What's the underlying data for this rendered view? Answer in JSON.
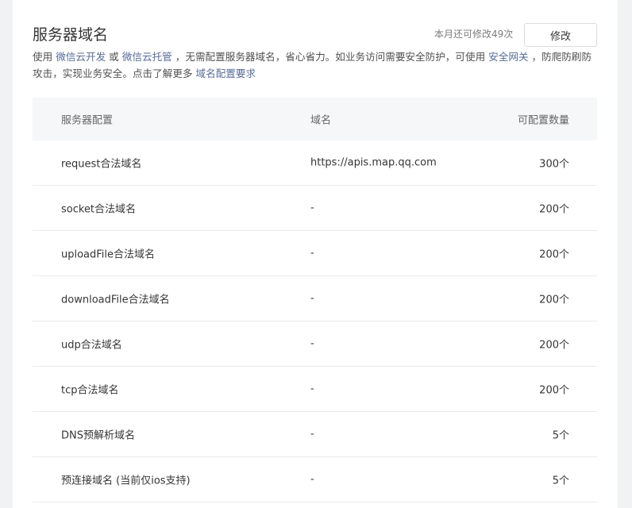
{
  "header": {
    "title": "服务器域名",
    "quota_text": "本月还可修改49次",
    "edit_label": "修改"
  },
  "description": {
    "p1": "使用 ",
    "link_cloud_dev": "微信云开发",
    "p2": " 或 ",
    "link_cloud_hosting": "微信云托管",
    "p3": " ，无需配置服务器域名，省心省力。如业务访问需要安全防护，可使用 ",
    "link_gateway": "安全网关",
    "p4": " ，防爬防刷防攻击，实现业务安全。点击了解更多 ",
    "link_domain_req": "域名配置要求"
  },
  "table": {
    "headers": {
      "config": "服务器配置",
      "domain": "域名",
      "count": "可配置数量"
    },
    "rows": [
      {
        "config": "request合法域名",
        "domain": "https://apis.map.qq.com",
        "count": "300个"
      },
      {
        "config": "socket合法域名",
        "domain": "-",
        "count": "200个"
      },
      {
        "config": "uploadFile合法域名",
        "domain": "-",
        "count": "200个"
      },
      {
        "config": "downloadFile合法域名",
        "domain": "-",
        "count": "200个"
      },
      {
        "config": "udp合法域名",
        "domain": "-",
        "count": "200个"
      },
      {
        "config": "tcp合法域名",
        "domain": "-",
        "count": "200个"
      },
      {
        "config": "DNS预解析域名",
        "domain": "-",
        "count": "5个"
      },
      {
        "config": "预连接域名 (当前仅ios支持)",
        "domain": "-",
        "count": "5个"
      }
    ]
  }
}
